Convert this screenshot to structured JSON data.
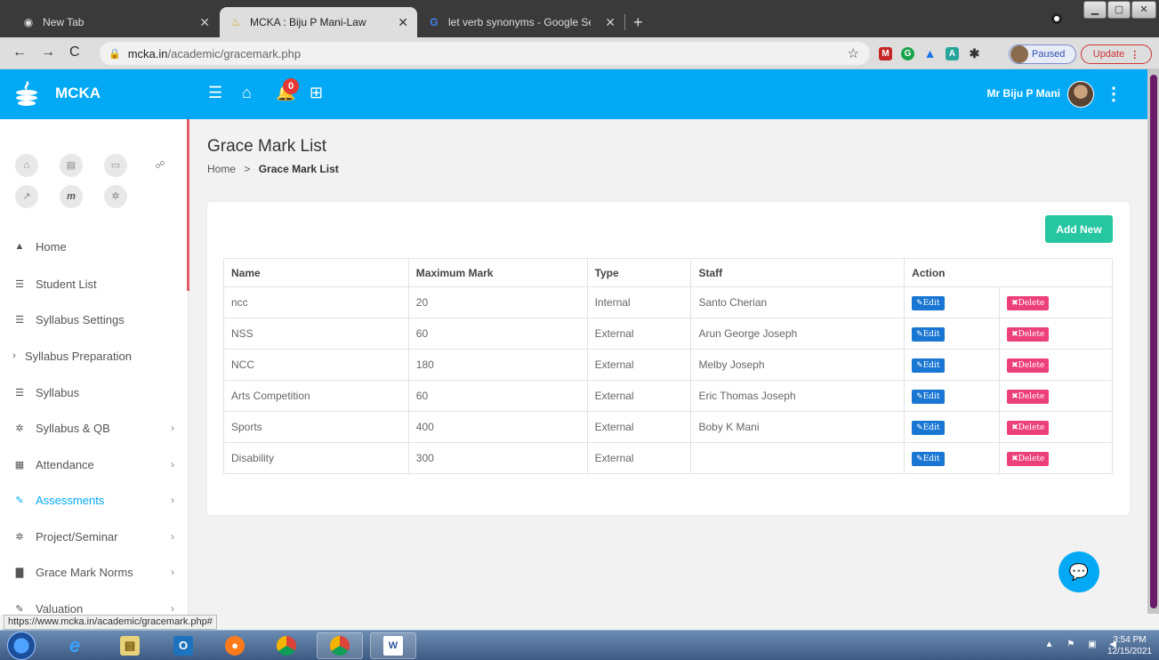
{
  "browser": {
    "tabs": [
      {
        "label": "New Tab",
        "icon": "chrome-icon"
      },
      {
        "label": "MCKA : Biju P Mani-Law",
        "icon": "mcka-icon",
        "active": true
      },
      {
        "label": "let verb synonyms - Google Sear",
        "icon": "google-icon"
      }
    ],
    "new_tab": "+",
    "address": {
      "domain": "mcka.in",
      "path": "/academic/gracemark.php"
    },
    "profile_status": "Paused",
    "update_label": "Update"
  },
  "app": {
    "brand": "MCKA",
    "notification_count": "0",
    "user_name": "Mr Biju P Mani",
    "accent_color": "#03a9f4"
  },
  "sidebar": {
    "quick_icons": [
      "home-icon",
      "id-card-icon",
      "lock-icon",
      "handshake-icon",
      "external-link-icon",
      "m-icon",
      "gear-icon"
    ],
    "items": [
      {
        "label": "Home",
        "icon": "home-icon"
      },
      {
        "label": "Student List",
        "icon": "list-icon"
      },
      {
        "label": "Syllabus Settings",
        "icon": "list-icon"
      },
      {
        "label": "Syllabus Preparation",
        "icon": "chevron-right-icon"
      },
      {
        "label": "Syllabus",
        "icon": "list-icon"
      },
      {
        "label": "Syllabus & QB",
        "icon": "cogs-icon",
        "has_children": true
      },
      {
        "label": "Attendance",
        "icon": "calendar-icon",
        "has_children": true
      },
      {
        "label": "Assessments",
        "icon": "pencil-icon",
        "has_children": true,
        "active": true
      },
      {
        "label": "Project/Seminar",
        "icon": "cogs-icon",
        "has_children": true
      },
      {
        "label": "Grace Mark Norms",
        "icon": "table-icon",
        "has_children": true
      },
      {
        "label": "Valuation",
        "icon": "pencil-icon",
        "has_children": true
      }
    ]
  },
  "main": {
    "title": "Grace Mark List",
    "breadcrumb": {
      "home": "Home",
      "separator": ">",
      "current": "Grace Mark List"
    },
    "add_new_label": "Add New",
    "table": {
      "headers": [
        "Name",
        "Maximum Mark",
        "Type",
        "Staff",
        "Action"
      ],
      "rows": [
        {
          "name": "ncc",
          "max": "20",
          "type": "Internal",
          "staff": "Santo Cherian"
        },
        {
          "name": "NSS",
          "max": "60",
          "type": "External",
          "staff": "Arun George Joseph"
        },
        {
          "name": "NCC",
          "max": "180",
          "type": "External",
          "staff": "Melby Joseph"
        },
        {
          "name": "Arts Competition",
          "max": "60",
          "type": "External",
          "staff": "Eric Thomas Joseph"
        },
        {
          "name": "Sports",
          "max": "400",
          "type": "External",
          "staff": "Boby K Mani"
        },
        {
          "name": "Disability",
          "max": "300",
          "type": "External",
          "staff": ""
        }
      ],
      "edit_label": "Edit",
      "delete_label": "Delete"
    }
  },
  "status_url": "https://www.mcka.in/academic/gracemark.php#",
  "taskbar": {
    "time": "3:54 PM",
    "date": "12/15/2021",
    "apps": [
      "ie-icon",
      "explorer-icon",
      "outlook-icon",
      "firefox-icon",
      "chrome-icon",
      "chrome-profile-icon",
      "word-icon"
    ]
  }
}
